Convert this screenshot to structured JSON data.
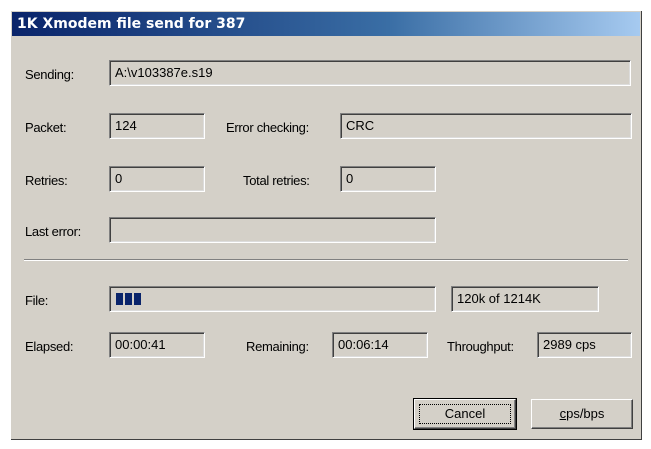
{
  "window": {
    "title": "1K Xmodem file send for 387"
  },
  "sending": {
    "label": "Sending:",
    "value": "A:\\v103387e.s19"
  },
  "packet": {
    "label": "Packet:",
    "value": "124"
  },
  "error_checking": {
    "label": "Error checking:",
    "value": "CRC"
  },
  "retries": {
    "label": "Retries:",
    "value": "0"
  },
  "total_retries": {
    "label": "Total retries:",
    "value": "0"
  },
  "last_error": {
    "label": "Last error:",
    "value": ""
  },
  "file": {
    "label": "File:",
    "progress_fraction": 0.099,
    "progress_text": "120k of 1214K"
  },
  "elapsed": {
    "label": "Elapsed:",
    "value": "00:00:41"
  },
  "remaining": {
    "label": "Remaining:",
    "value": "00:06:14"
  },
  "throughput": {
    "label": "Throughput:",
    "value": "2989 cps"
  },
  "buttons": {
    "cancel_label": "Cancel",
    "cps_bps_label_first": "c",
    "cps_bps_label_rest": "ps/bps"
  },
  "colors": {
    "title_bar": "#0a246a",
    "dialog_face": "#d4d0c8",
    "progress_fill": "#0a246a"
  }
}
